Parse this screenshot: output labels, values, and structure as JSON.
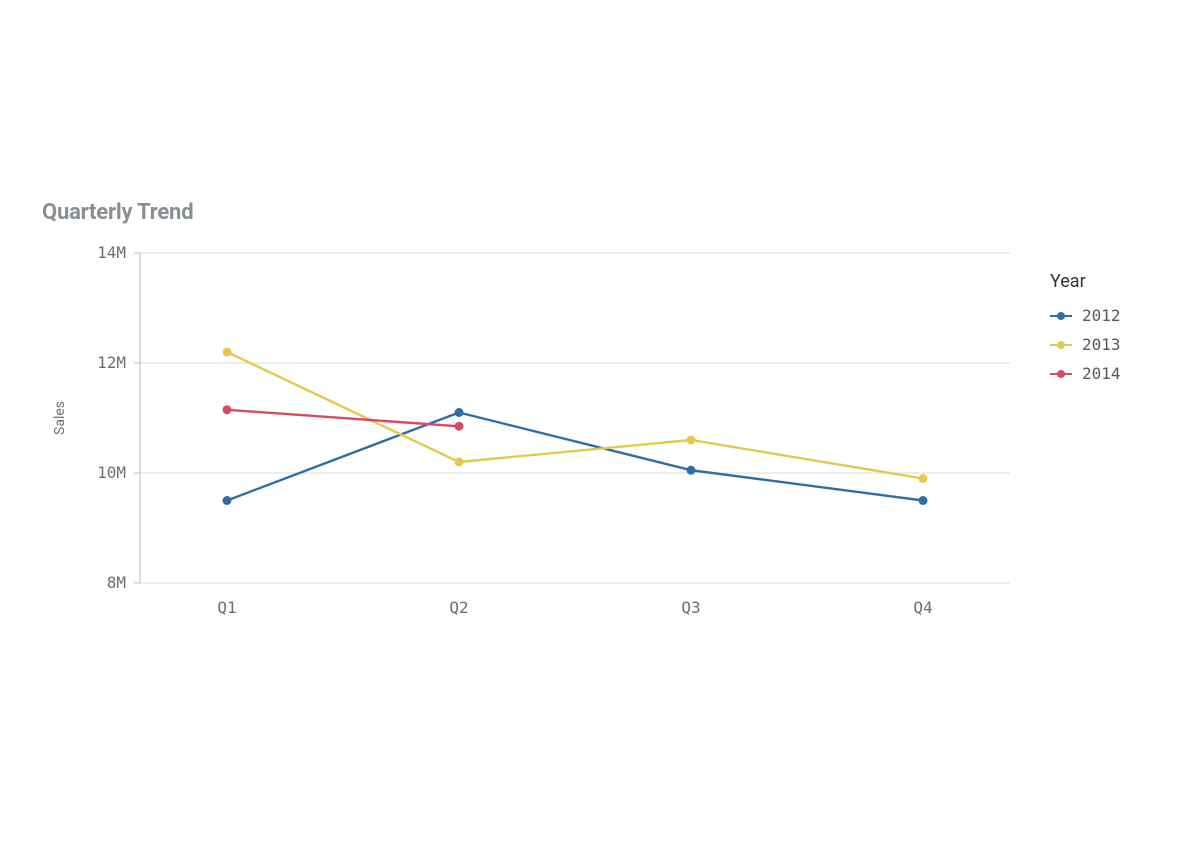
{
  "chart_data": {
    "type": "line",
    "title": "Quarterly Trend",
    "ylabel": "Sales",
    "xlabel": "",
    "categories": [
      "Q1",
      "Q2",
      "Q3",
      "Q4"
    ],
    "y_ticks": [
      8,
      10,
      12,
      14
    ],
    "y_tick_labels": [
      "8M",
      "10M",
      "12M",
      "14M"
    ],
    "ylim": [
      8,
      14
    ],
    "legend_title": "Year",
    "series": [
      {
        "name": "2012",
        "color": "#2f6da5",
        "values": [
          9.5,
          11.1,
          10.05,
          9.5
        ]
      },
      {
        "name": "2013",
        "color": "#e3c94f",
        "values": [
          12.2,
          10.2,
          10.6,
          9.9
        ]
      },
      {
        "name": "2014",
        "color": "#d74a63",
        "values": [
          11.15,
          10.85,
          null,
          null
        ]
      }
    ]
  }
}
